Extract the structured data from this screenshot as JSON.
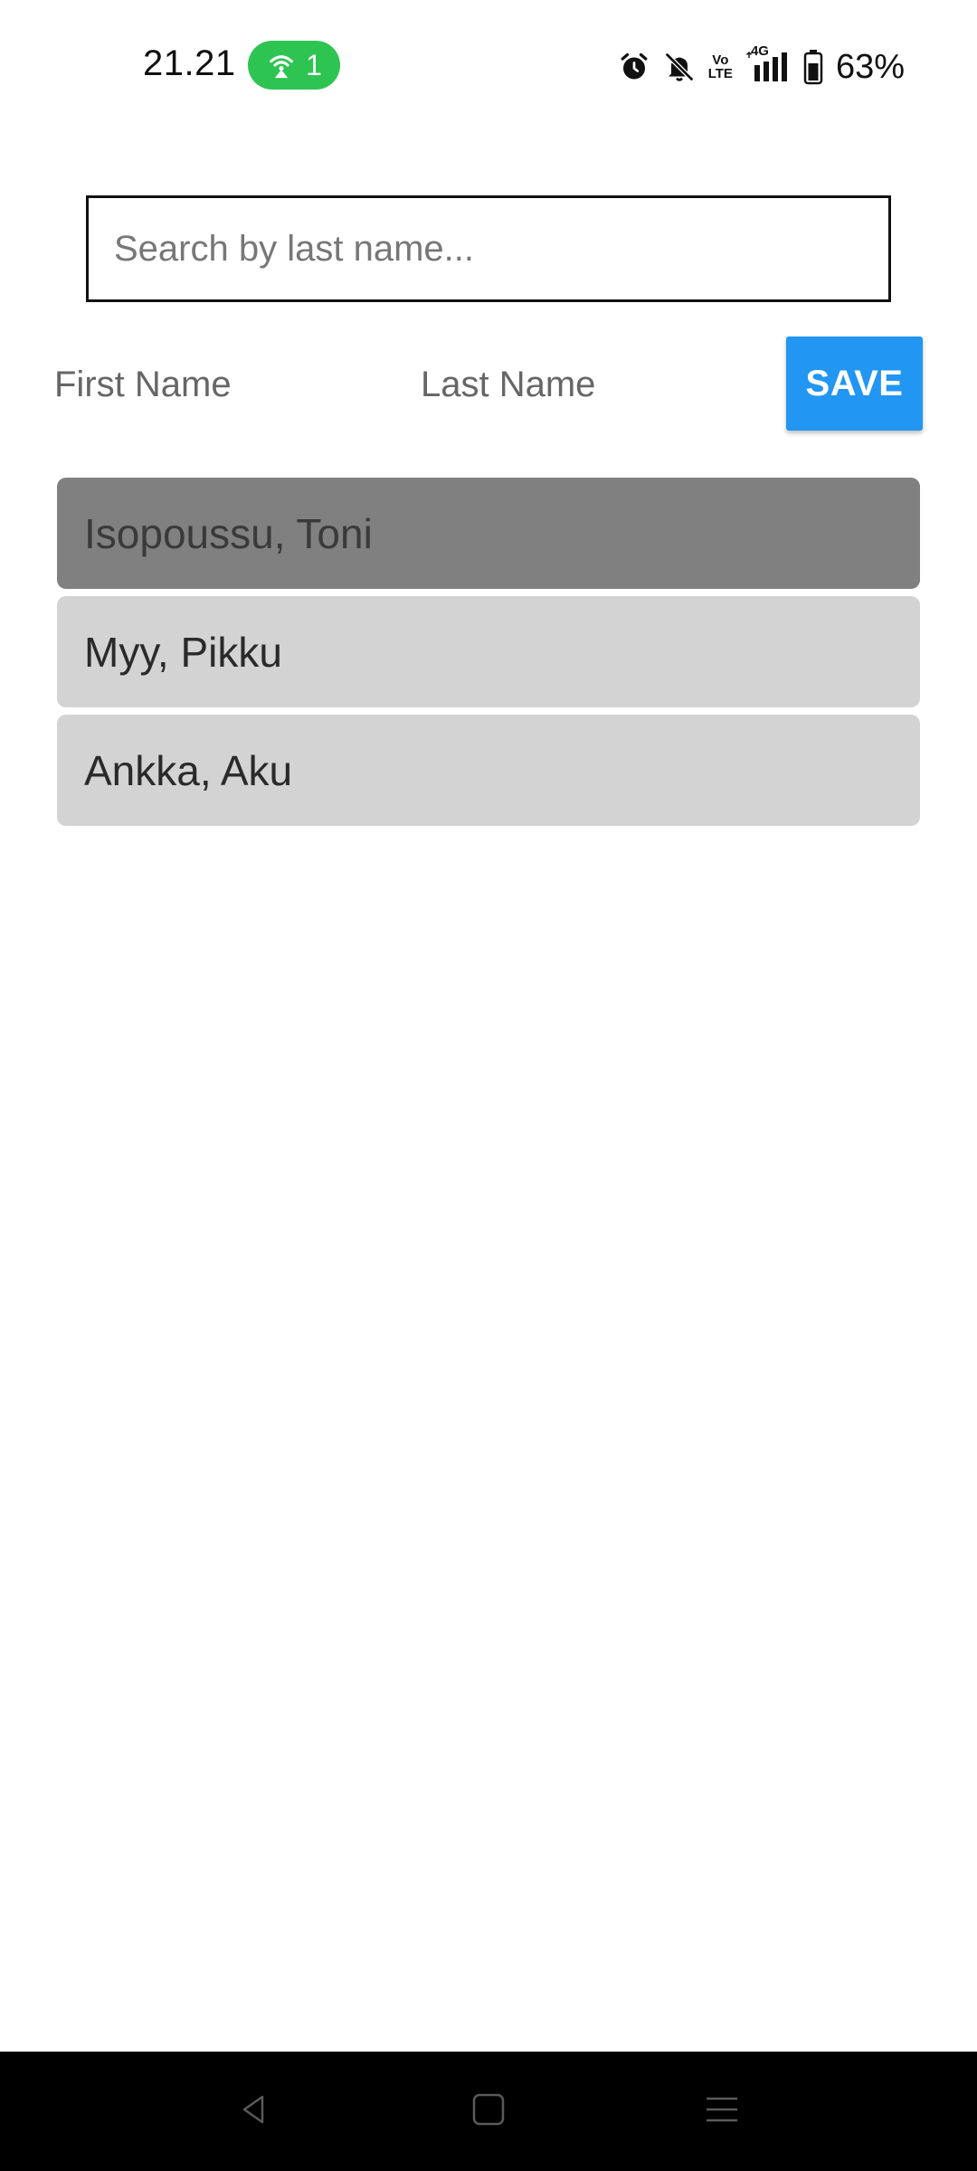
{
  "status_bar": {
    "time": "21.21",
    "hotspot_count": "1",
    "battery_percent": "63%",
    "volte_line1": "Vo",
    "volte_line2": "LTE",
    "network": "4G",
    "icons": [
      "alarm-icon",
      "bell-off-icon",
      "volte-icon",
      "signal-icon",
      "battery-icon"
    ],
    "hotspot_color": "#2ec452"
  },
  "search": {
    "placeholder": "Search by last name...",
    "value": ""
  },
  "form": {
    "first_name_placeholder": "First Name",
    "last_name_placeholder": "Last Name",
    "save_label": "SAVE",
    "save_color": "#2196f3"
  },
  "people": [
    {
      "label": "Isopoussu, Toni",
      "selected": true
    },
    {
      "label": "Myy, Pikku",
      "selected": false
    },
    {
      "label": "Ankka, Aku",
      "selected": false
    }
  ],
  "colors": {
    "item_background": "#d3d3d3",
    "selected_item_background": "#808080"
  },
  "nav_bar": {
    "icons": [
      "back-icon",
      "home-icon",
      "menu-icon"
    ]
  }
}
